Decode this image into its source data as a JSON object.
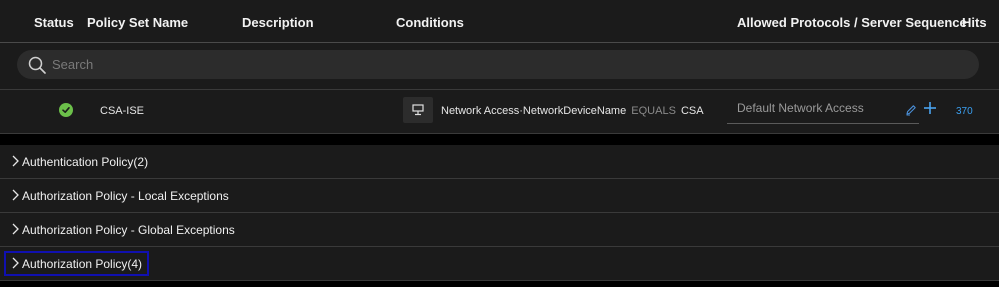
{
  "header": {
    "status": "Status",
    "policy_set_name": "Policy Set Name",
    "description": "Description",
    "conditions": "Conditions",
    "allowed_protocols": "Allowed Protocols / Server Sequence",
    "hits": "Hits"
  },
  "search": {
    "placeholder": "Search",
    "value": ""
  },
  "policy_row": {
    "status": "enabled",
    "name": "CSA-ISE",
    "condition_attribute": "Network Access·NetworkDeviceName",
    "condition_operator": "EQUALS",
    "condition_value": "CSA",
    "allowed_protocol": "Default Network Access",
    "hits": "370"
  },
  "sections": [
    {
      "label": "Authentication Policy(2)"
    },
    {
      "label": "Authorization Policy - Local Exceptions"
    },
    {
      "label": "Authorization Policy - Global Exceptions"
    },
    {
      "label": "Authorization Policy(4)"
    }
  ],
  "colors": {
    "background": "#1b1b1b",
    "status_green": "#6cc04a",
    "hits_blue": "#3a9ff0",
    "focus_blue": "#1010b0"
  }
}
